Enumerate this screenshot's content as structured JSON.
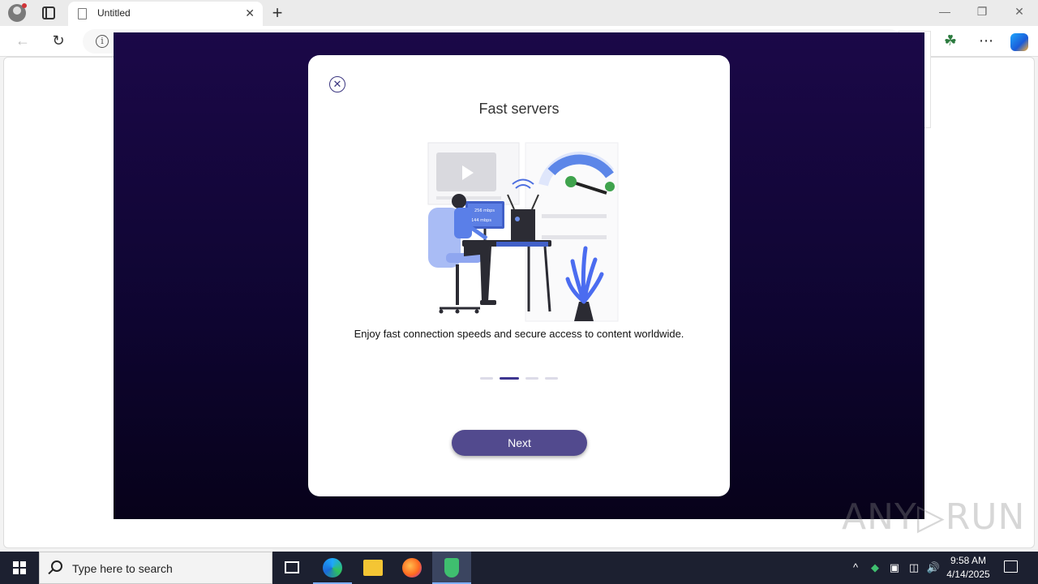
{
  "browser": {
    "tab_title": "Untitled",
    "tab_close": "✕",
    "new_tab": "+",
    "win_minimize": "—",
    "win_restore": "❐",
    "win_close": "✕",
    "info_glyph": "i",
    "more_glyph": "⋯",
    "extension_glyph": "☘"
  },
  "modal": {
    "close_glyph": "✕",
    "title": "Fast servers",
    "description": "Enjoy fast connection speeds and secure access to content worldwide.",
    "carousel": {
      "count": 4,
      "active_index": 1
    },
    "next_label": "Next",
    "illustration_labels": {
      "download": "256 mbps",
      "upload": "144 mbps"
    },
    "colors": {
      "accent": "#3d3590",
      "button": "#524a8e",
      "background": "#1b0848"
    }
  },
  "watermark": "ANY▷RUN",
  "taskbar": {
    "search_placeholder": "Type here to search",
    "time": "9:58 AM",
    "date": "4/14/2025",
    "tray_chevron": "^",
    "tray_volume": "🔊"
  }
}
